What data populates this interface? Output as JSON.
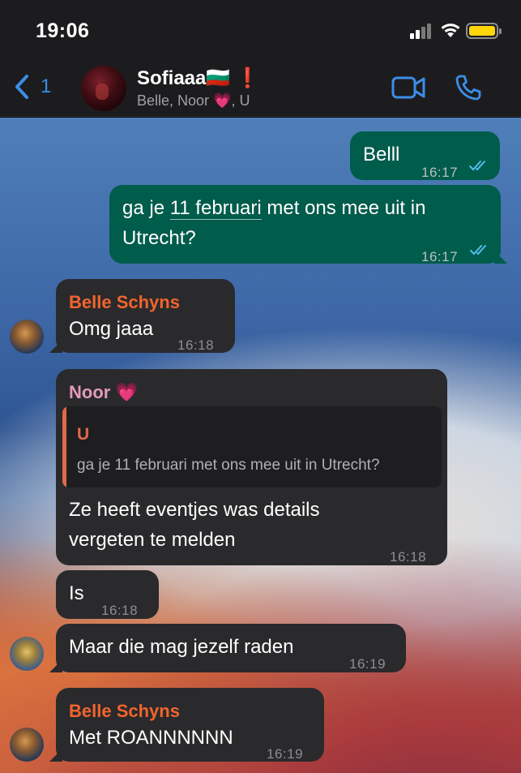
{
  "status_bar": {
    "time": "19:06"
  },
  "header": {
    "back_count": "1",
    "group_name": "Sofiaaa🇧🇬 ❗",
    "participants": "Belle, Noor 💗, U"
  },
  "messages": [
    {
      "id": "m1",
      "direction": "out",
      "text": "Belll",
      "time": "16:17",
      "read": true
    },
    {
      "id": "m2",
      "direction": "out",
      "text_before": "ga je ",
      "text_link": "11 februari",
      "text_after": " met ons mee uit in",
      "text_line2": "Utrecht?",
      "time": "16:17",
      "read": true
    },
    {
      "id": "m3",
      "direction": "in",
      "sender": "Belle Schyns",
      "text": "Omg jaaa",
      "time": "16:18"
    },
    {
      "id": "m4",
      "direction": "in",
      "sender": "Noor 💗",
      "quote": {
        "name": "U",
        "text": "ga je 11 februari met ons mee uit in Utrecht?"
      },
      "text_line1": "Ze heeft eventjes was details",
      "text_line2": "vergeten te melden",
      "time": "16:18"
    },
    {
      "id": "m5",
      "direction": "in",
      "text": "Is",
      "time": "16:18"
    },
    {
      "id": "m6",
      "direction": "in",
      "text": "Maar die mag jezelf raden",
      "time": "16:19"
    },
    {
      "id": "m7",
      "direction": "in",
      "sender": "Belle Schyns",
      "text": "Met ROANNNNNN",
      "time": "16:19"
    }
  ],
  "colors": {
    "accent": "#3b8ee8",
    "outgoing_bubble": "#005c4b",
    "incoming_bubble": "#2a2a2c",
    "sender_belle": "#f2642d",
    "sender_noor": "#e29bb5",
    "read_ticks": "#53bdeb"
  }
}
